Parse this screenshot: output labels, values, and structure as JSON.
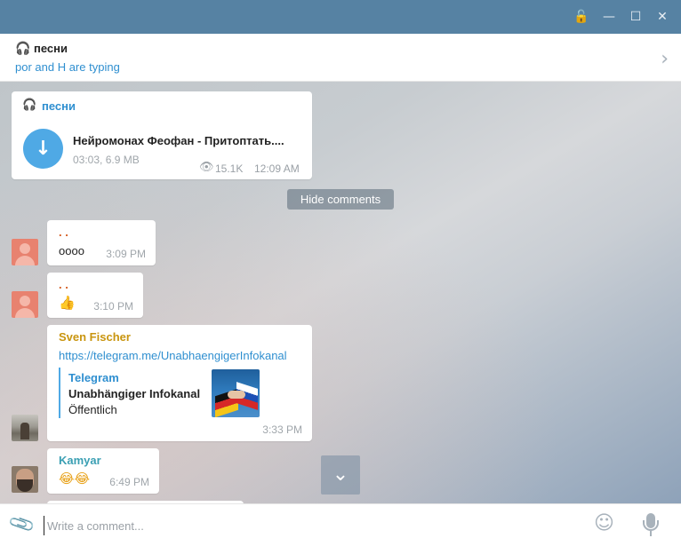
{
  "window": {
    "lock_icon": "🔓",
    "minimize_icon": "—",
    "maximize_icon": "☐",
    "close_icon": "✕"
  },
  "header": {
    "channel_icon": "🎧",
    "channel_name": "песни",
    "typing_status": "por and H are typing",
    "info_chevron": "›"
  },
  "post": {
    "channel_icon": "🎧",
    "channel_name": "песни",
    "download_icon": "↓",
    "audio_title": "Нейромонах Феофан - Притоптать....",
    "audio_meta": "03:03, 6.9 MB",
    "views_icon": "👁",
    "views": "15.1K",
    "time": "12:09 AM"
  },
  "hide_comments_label": "Hide comments",
  "messages": [
    {
      "sender": ". .",
      "sender_color": "#d45a1e",
      "text": "oooo",
      "time": "3:09 PM"
    },
    {
      "sender": ". .",
      "sender_color": "#d45a1e",
      "text": "👍",
      "time": "3:10 PM"
    },
    {
      "sender": "Sven Fischer",
      "sender_color": "#c9950f",
      "link": "https://telegram.me/UnabhaengigerInfokanal",
      "preview": {
        "site": "Telegram",
        "title": "Unabhängiger Infokanal",
        "description": "Öffentlich"
      },
      "time": "3:33 PM"
    },
    {
      "sender": "Kamyar",
      "sender_color": "#3a9fb3",
      "text": "😂😂",
      "time": "6:49 PM"
    }
  ],
  "scroll_down_icon": "⌄",
  "composer": {
    "attach_icon": "📎",
    "placeholder": "Write a comment...",
    "emoji_icon": "☺"
  },
  "colors": {
    "titlebar": "#5682a3",
    "accent": "#2f8fd0",
    "download_button": "#4fa9e5"
  }
}
